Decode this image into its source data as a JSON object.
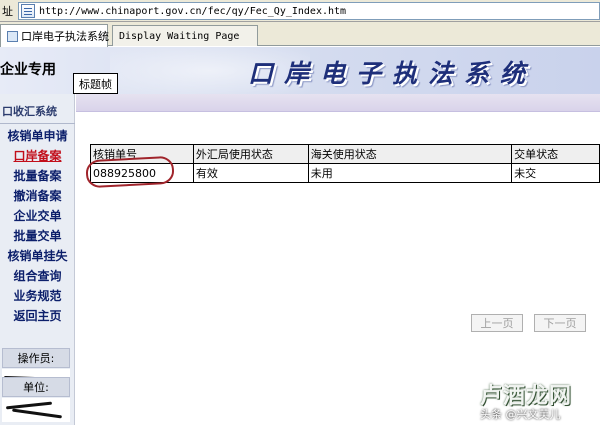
{
  "browser": {
    "address_label": "址",
    "url": "http://www.chinaport.gov.cn/fec/qy/Fec_Qy_Index.htm",
    "tabs": [
      {
        "label": "口岸电子执法系统",
        "active": true
      },
      {
        "label": "Display Waiting Page",
        "active": false
      }
    ]
  },
  "header": {
    "left_text": "企业专用",
    "title": "口岸电子执法系统",
    "frame_label": "标题帧"
  },
  "sidebar": {
    "section_title": "口收汇系统",
    "items": [
      {
        "label": "核销单申请",
        "current": false
      },
      {
        "label": "口岸备案",
        "current": true
      },
      {
        "label": "批量备案",
        "current": false
      },
      {
        "label": "撤消备案",
        "current": false
      },
      {
        "label": "企业交单",
        "current": false
      },
      {
        "label": "批量交单",
        "current": false
      },
      {
        "label": "核销单挂失",
        "current": false
      },
      {
        "label": "组合查询",
        "current": false
      },
      {
        "label": "业务规范",
        "current": false
      },
      {
        "label": "返回主页",
        "current": false
      }
    ],
    "operator_label": "操作员:",
    "unit_label": "单位:"
  },
  "table": {
    "headers": [
      "核销单号",
      "外汇局使用状态",
      "海关使用状态",
      "交单状态"
    ],
    "rows": [
      [
        "088925800",
        "有效",
        "未用",
        "未交"
      ]
    ]
  },
  "pager": {
    "prev_label": "上一页",
    "next_label": "下一页"
  },
  "watermark": {
    "logo": "卢酒龙网",
    "credit": "头条 @兴文芙儿"
  },
  "colors": {
    "title_blue": "#1e2f7a",
    "nav_blue": "#0c1f6b",
    "nav_current_red": "#c20e1a",
    "annotation_red": "#a0242b"
  }
}
